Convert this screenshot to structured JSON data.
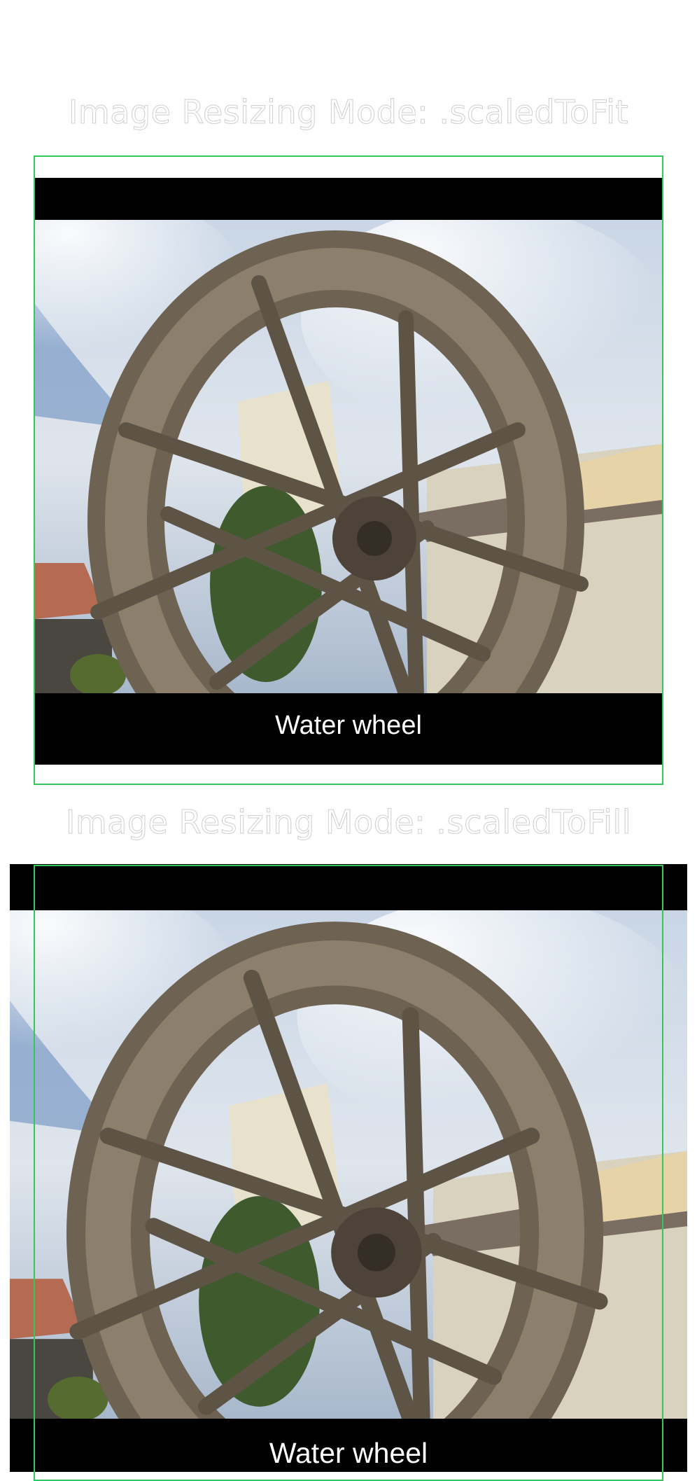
{
  "sections": [
    {
      "mode_title": "Image Resizing Mode: .scaledToFit",
      "caption": "Water wheel",
      "image_subject": "water-wheel-photo"
    },
    {
      "mode_title": "Image Resizing Mode: .scaledToFill",
      "caption": "Water wheel",
      "image_subject": "water-wheel-photo"
    }
  ],
  "colors": {
    "frame_border": "#34c759",
    "letterbox": "#000000",
    "caption_text": "#ffffff",
    "title_text": "#ffffff"
  }
}
